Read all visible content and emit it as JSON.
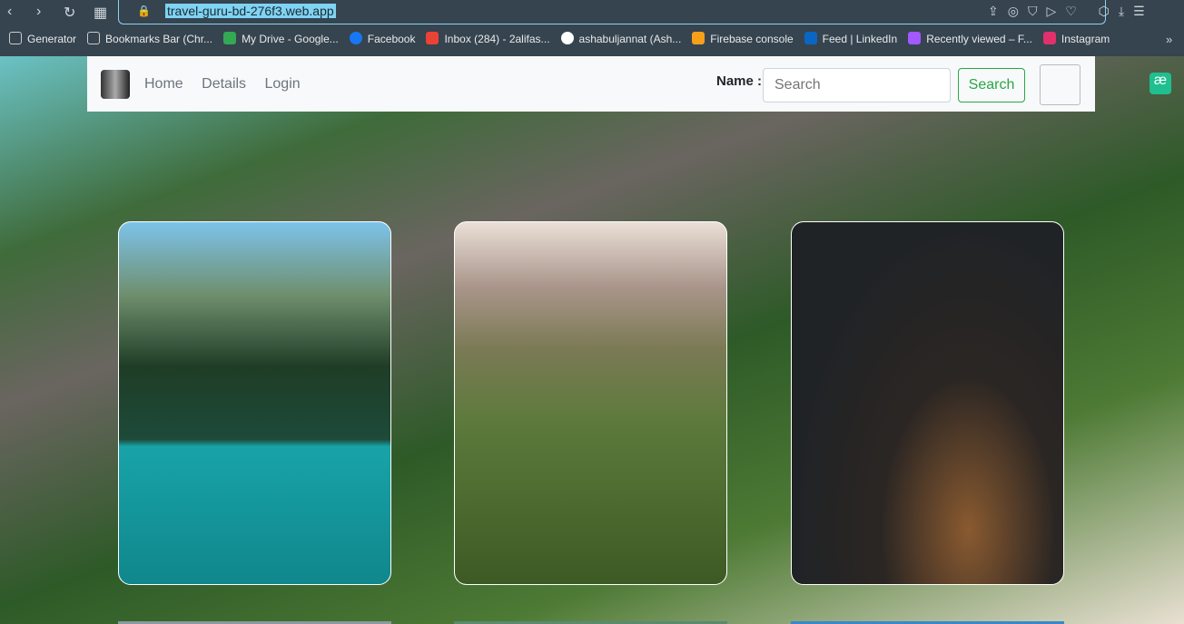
{
  "browser": {
    "url": "travel-guru-bd-276f3.web.app",
    "bookmarks": [
      "Generator",
      "Bookmarks Bar (Chr...",
      "My Drive - Google...",
      "Facebook",
      "Inbox (284) - 2alifas...",
      "ashabuljannat (Ash...",
      "Firebase console",
      "Feed | LinkedIn",
      "Recently viewed – F...",
      "Instagram"
    ],
    "bookmark_colors": [
      "#ccc",
      "#ccc",
      "#34a853",
      "#1877f2",
      "#ea4335",
      "#fff",
      "#f6a01a",
      "#0a66c2",
      "#a259ff",
      "#e1306c"
    ]
  },
  "navbar": {
    "links": [
      "Home",
      "Details",
      "Login"
    ],
    "name_label": "Name :",
    "search_placeholder": "Search",
    "search_button": "Search"
  },
  "accent": "#28a745"
}
